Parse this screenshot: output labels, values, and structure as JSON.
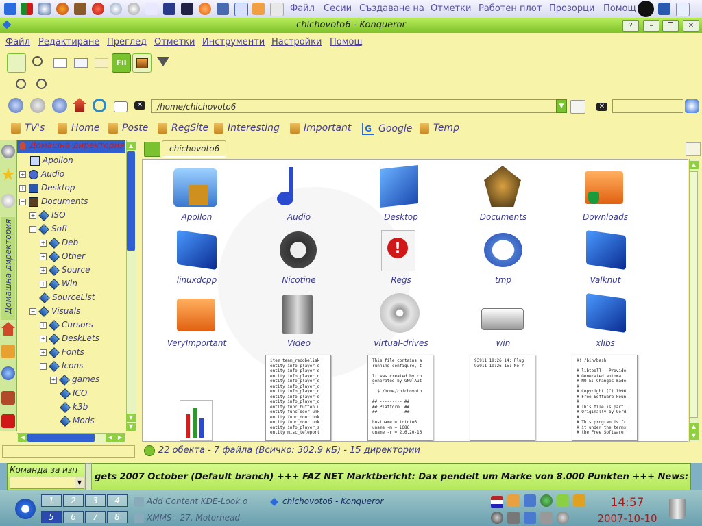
{
  "top_panel": {
    "menu": [
      "Файл",
      "Сесии",
      "Създаване на",
      "Отметки",
      "Работен плот",
      "Прозорци",
      "Помощ"
    ]
  },
  "window": {
    "title": "chichovoto6 - Konqueror",
    "controls": [
      "?",
      "–",
      "❐",
      "✕"
    ]
  },
  "menubar": [
    "Файл",
    "Редактиране",
    "Преглед",
    "Отметки",
    "Инструменти",
    "Настройки",
    "Помощ"
  ],
  "location": {
    "value": "/home/chichovoto6"
  },
  "bookmarks": [
    "TV's",
    "Home",
    "Poste",
    "RegSite",
    "Interesting",
    "Important",
    "Google",
    "Temp"
  ],
  "sidebar": {
    "vertical_label": "Домашна директория",
    "tree": [
      {
        "label": "Домашна директория",
        "level": 0,
        "expander": "",
        "selected": true
      },
      {
        "label": "Apollon",
        "level": 1,
        "expander": ""
      },
      {
        "label": "Audio",
        "level": 1,
        "expander": "+"
      },
      {
        "label": "Desktop",
        "level": 1,
        "expander": "+"
      },
      {
        "label": "Documents",
        "level": 1,
        "expander": "−"
      },
      {
        "label": "ISO",
        "level": 2,
        "expander": "+"
      },
      {
        "label": "Soft",
        "level": 2,
        "expander": "−"
      },
      {
        "label": "Deb",
        "level": 3,
        "expander": "+"
      },
      {
        "label": "Other",
        "level": 3,
        "expander": "+"
      },
      {
        "label": "Source",
        "level": 3,
        "expander": "+"
      },
      {
        "label": "Win",
        "level": 3,
        "expander": "+"
      },
      {
        "label": "SourceList",
        "level": 2,
        "expander": ""
      },
      {
        "label": "Visuals",
        "level": 2,
        "expander": "−"
      },
      {
        "label": "Cursors",
        "level": 3,
        "expander": "+"
      },
      {
        "label": "DeskLets",
        "level": 3,
        "expander": "+"
      },
      {
        "label": "Fonts",
        "level": 3,
        "expander": "+"
      },
      {
        "label": "Icons",
        "level": 3,
        "expander": "−"
      },
      {
        "label": "games",
        "level": 4,
        "expander": "+"
      },
      {
        "label": "ICO",
        "level": 4,
        "expander": ""
      },
      {
        "label": "k3b",
        "level": 4,
        "expander": ""
      },
      {
        "label": "Mods",
        "level": 4,
        "expander": ""
      }
    ]
  },
  "tab": {
    "label": "chichovoto6"
  },
  "icons": [
    {
      "label": "Apollon",
      "icon": "folder-library-icon"
    },
    {
      "label": "Audio",
      "icon": "music-note-icon"
    },
    {
      "label": "Desktop",
      "icon": "desktop-icon"
    },
    {
      "label": "Documents",
      "icon": "documents-icon"
    },
    {
      "label": "Downloads",
      "icon": "downloads-folder-icon"
    },
    {
      "label": "linuxdcpp",
      "icon": "debian-book-icon"
    },
    {
      "label": "Nicotine",
      "icon": "nicotine-icon"
    },
    {
      "label": "Regs",
      "icon": "warning-document-icon"
    },
    {
      "label": "tmp",
      "icon": "clock-book-icon"
    },
    {
      "label": "Valknut",
      "icon": "debian-book-icon"
    },
    {
      "label": "VeryImportant",
      "icon": "folder-icon"
    },
    {
      "label": "Video",
      "icon": "video-icon"
    },
    {
      "label": "virtual-drives",
      "icon": "cdrom-icon"
    },
    {
      "label": "win",
      "icon": "harddisk-icon"
    },
    {
      "label": "xlibs",
      "icon": "debian-book-icon"
    }
  ],
  "previews": [
    {
      "lines": "item team_redobelisk\nentity info_player_d\nentity info_player_d\nentity info_player_d\nentity info_player_d\nentity info_player_d\nentity info_player_d\nentity info_player_d\nentity info_player_d\nentity func_button u\nentity func_door unk\nentity func_door unk\nentity func_door unk\nentity info_player_s\nentity misc_teleport"
    },
    {
      "lines": "This file contains a\nrunning configure, t\n\nIt was created by co\ngenerated by GNU Aut\n\n  $ /home/chichovoto\n\n## --------- ##\n## Platform. ##\n## --------- ##\n\nhostname = tototo6\nuname -m = i686\nuname -r = 2.6.20-16"
    },
    {
      "lines": "93911 19:26:14: Plug\n93911 19:26:15: No r"
    },
    {
      "lines": "#! /bin/bash\n\n# libtoolT - Provide\n# Generated automati\n# NOTE: Changes made\n#\n# Copyright (C) 1996\n# Free Software Foun\n#\n# This file is part\n# Originally by Gord\n#\n# This program is fr\n# it under the terms\n# the Free Software"
    }
  ],
  "status": {
    "text": "22 обекта - 7 файла (Всичко: 302.9 кБ) - 15 директории"
  },
  "ticker": {
    "command_label": "Команда за изп",
    "text": "gets 2007 October (Default branch) +++ FAZ NET Marktbericht: Dax pendelt um Marke von 8.000 Punkten +++ News: Retailers look"
  },
  "pager": [
    "1",
    "2",
    "3",
    "4",
    "5",
    "6",
    "7",
    "8"
  ],
  "tasks": [
    {
      "label": "Add Content KDE-Look.o"
    },
    {
      "label": "chichovoto6 - Konqueror"
    },
    {
      "label": "XMMS - 27. Motorhead"
    }
  ],
  "clock": {
    "time": "14:57",
    "date": "2007-10-10"
  },
  "colors": {
    "accent_green": "#7ac230",
    "window_bg": "#f7f3a8",
    "link_text": "#4a3da0",
    "clock_red": "#b01818"
  }
}
